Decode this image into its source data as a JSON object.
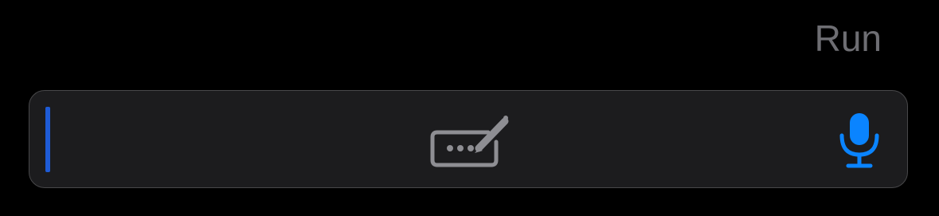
{
  "header": {
    "run_label": "Run"
  },
  "input_bar": {
    "value": "",
    "placeholder": "",
    "scribble_icon": "keyboard-pencil-icon",
    "mic_icon": "microphone-icon"
  },
  "colors": {
    "background": "#000000",
    "bar": "#1c1c1e",
    "bar_border": "#48484a",
    "run_disabled": "#6e6e73",
    "accent": "#0a84ff",
    "cursor": "#1e5bd6",
    "icon_gray": "#8e8e93"
  }
}
